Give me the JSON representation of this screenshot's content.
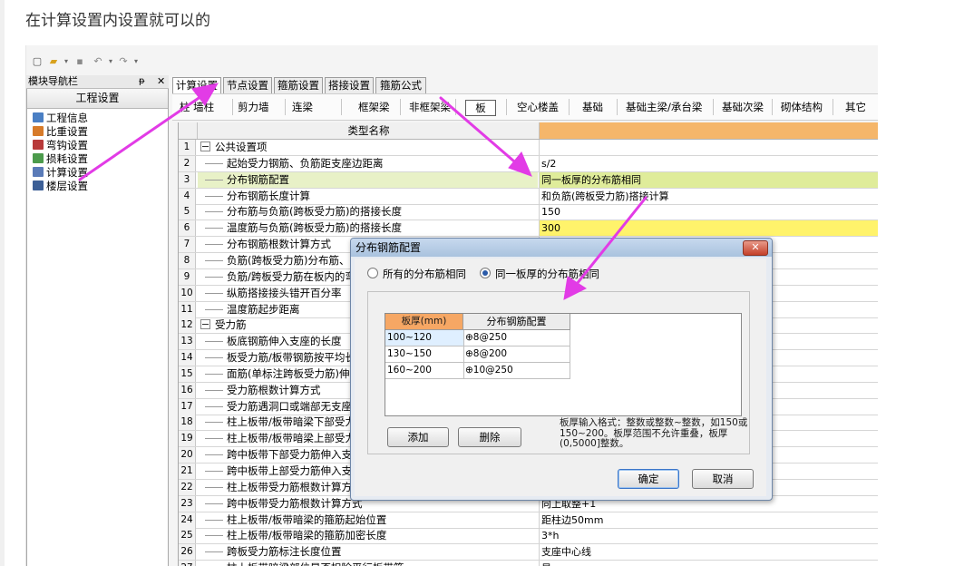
{
  "caption": "在计算设置内设置就可以的",
  "quick_access": {
    "icons": [
      "new-file-icon",
      "open-folder-icon",
      "dropdown-icon",
      "save-icon",
      "undo-icon",
      "dropdown-icon",
      "redo-icon",
      "dropdown-icon"
    ]
  },
  "nav": {
    "header": "模块导航栏",
    "pin": "ᵽ",
    "close": "✕",
    "title": "工程设置",
    "items": [
      {
        "label": "工程信息",
        "icon": "info-icon"
      },
      {
        "label": "比重设置",
        "icon": "ratio-icon"
      },
      {
        "label": "弯钩设置",
        "icon": "hook-icon"
      },
      {
        "label": "损耗设置",
        "icon": "loss-icon"
      },
      {
        "label": "计算设置",
        "icon": "calc-icon"
      },
      {
        "label": "楼层设置",
        "icon": "floor-icon"
      }
    ]
  },
  "tabs": [
    "计算设置",
    "节点设置",
    "箍筋设置",
    "搭接设置",
    "箍筋公式"
  ],
  "toolbar": [
    "柱 墙柱",
    "剪力墙",
    "连梁",
    "框架梁",
    "非框架梁",
    "板",
    "空心楼盖",
    "基础",
    "基础主梁/承台梁",
    "基础次梁",
    "砌体结构",
    "其它"
  ],
  "grid": {
    "header_name": "类型名称",
    "rows": [
      {
        "n": "1",
        "name": "公共设置项",
        "value": "",
        "group": true
      },
      {
        "n": "2",
        "name": "起始受力钢筋、负筋距支座边距离",
        "value": "s/2"
      },
      {
        "n": "3",
        "name": "分布钢筋配置",
        "value": "同一板厚的分布筋相同",
        "hl": true
      },
      {
        "n": "4",
        "name": "分布钢筋长度计算",
        "value": "和负筋(跨板受力筋)搭接计算"
      },
      {
        "n": "5",
        "name": "分布筋与负筋(跨板受力筋)的搭接长度",
        "value": "150"
      },
      {
        "n": "6",
        "name": "温度筋与负筋(跨板受力筋)的搭接长度",
        "value": "300",
        "yl": true
      },
      {
        "n": "7",
        "name": "分布钢筋根数计算方式",
        "value": ""
      },
      {
        "n": "8",
        "name": "负筋(跨板受力筋)分布筋、温",
        "value": ""
      },
      {
        "n": "9",
        "name": "负筋/跨板受力筋在板内的弯",
        "value": ""
      },
      {
        "n": "10",
        "name": "纵筋搭接接头错开百分率",
        "value": ""
      },
      {
        "n": "11",
        "name": "温度筋起步距离",
        "value": ""
      },
      {
        "n": "12",
        "name": "受力筋",
        "value": "",
        "group": true
      },
      {
        "n": "13",
        "name": "板底钢筋伸入支座的长度",
        "value": ""
      },
      {
        "n": "14",
        "name": "板受力筋/板带钢筋按平均长",
        "value": ""
      },
      {
        "n": "15",
        "name": "面筋(单标注跨板受力筋)伸入",
        "value": ""
      },
      {
        "n": "16",
        "name": "受力筋根数计算方式",
        "value": ""
      },
      {
        "n": "17",
        "name": "受力筋遇洞口或端部无支座时",
        "value": ""
      },
      {
        "n": "18",
        "name": "柱上板带/板带暗梁下部受力",
        "value": ""
      },
      {
        "n": "19",
        "name": "柱上板带/板带暗梁上部受力",
        "value": ""
      },
      {
        "n": "20",
        "name": "跨中板带下部受力筋伸入支座",
        "value": ""
      },
      {
        "n": "21",
        "name": "跨中板带上部受力筋伸入支座",
        "value": ""
      },
      {
        "n": "22",
        "name": "柱上板带受力筋根数计算方式",
        "value": ""
      },
      {
        "n": "23",
        "name": "跨中板带受力筋根数计算方式",
        "value": "向上取整+1"
      },
      {
        "n": "24",
        "name": "柱上板带/板带暗梁的箍筋起始位置",
        "value": "距柱边50mm"
      },
      {
        "n": "25",
        "name": "柱上板带/板带暗梁的箍筋加密长度",
        "value": "3*h"
      },
      {
        "n": "26",
        "name": "跨板受力筋标注长度位置",
        "value": "支座中心线"
      },
      {
        "n": "27",
        "name": "柱上板带暗梁部位是否扣除平行板带筋",
        "value": "是"
      }
    ]
  },
  "dialog": {
    "title": "分布钢筋配置",
    "close": "✕",
    "radio_all": "所有的分布筋相同",
    "radio_same": "同一板厚的分布筋相同",
    "col_thickness": "板厚(mm)",
    "col_config": "分布钢筋配置",
    "rows": [
      {
        "thickness": "100~120",
        "config": "⊕8@250"
      },
      {
        "thickness": "130~150",
        "config": "⊕8@200"
      },
      {
        "thickness": "160~200",
        "config": "⊕10@250"
      }
    ],
    "add": "添加",
    "delete": "删除",
    "hint": "板厚输入格式：整数或整数~整数，如150或150~200。板厚范围不允许重叠，板厚(0,5000]整数。",
    "ok": "确定",
    "cancel": "取消"
  },
  "colors": {
    "arrow": "#e23be6",
    "header_accent": "#f5b66a",
    "highlight_row": "#dfec9a",
    "yellow_cell": "#fff36b"
  }
}
